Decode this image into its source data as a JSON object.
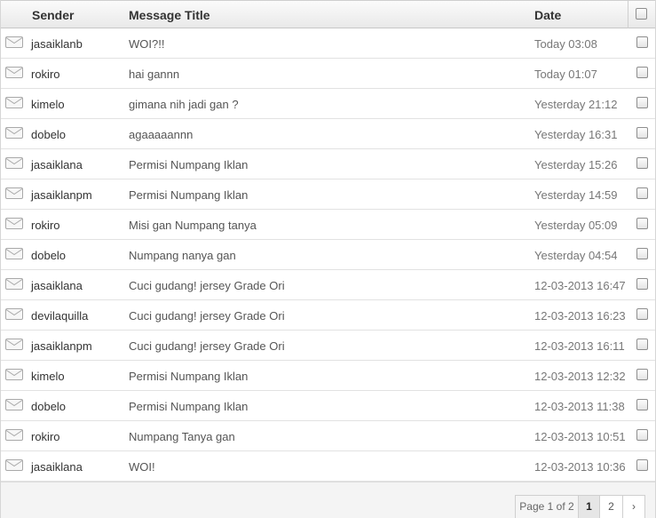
{
  "header": {
    "sender": "Sender",
    "title": "Message Title",
    "date": "Date"
  },
  "icon": "envelope-icon",
  "messages": [
    {
      "sender": "jasaiklanb",
      "title": "WOI?!!",
      "date": "Today 03:08"
    },
    {
      "sender": "rokiro",
      "title": "hai gannn",
      "date": "Today 01:07"
    },
    {
      "sender": "kimelo",
      "title": "gimana nih jadi gan ?",
      "date": "Yesterday 21:12"
    },
    {
      "sender": "dobelo",
      "title": "agaaaaannn",
      "date": "Yesterday 16:31"
    },
    {
      "sender": "jasaiklana",
      "title": "Permisi Numpang Iklan",
      "date": "Yesterday 15:26"
    },
    {
      "sender": "jasaiklanpm",
      "title": "Permisi Numpang Iklan",
      "date": "Yesterday 14:59"
    },
    {
      "sender": "rokiro",
      "title": "Misi gan Numpang tanya",
      "date": "Yesterday 05:09"
    },
    {
      "sender": "dobelo",
      "title": "Numpang nanya gan",
      "date": "Yesterday 04:54"
    },
    {
      "sender": "jasaiklana",
      "title": "Cuci gudang! jersey Grade Ori",
      "date": "12-03-2013 16:47"
    },
    {
      "sender": "devilaquilla",
      "title": "Cuci gudang! jersey Grade Ori",
      "date": "12-03-2013 16:23"
    },
    {
      "sender": "jasaiklanpm",
      "title": "Cuci gudang! jersey Grade Ori",
      "date": "12-03-2013 16:11"
    },
    {
      "sender": "kimelo",
      "title": "Permisi Numpang Iklan",
      "date": "12-03-2013 12:32"
    },
    {
      "sender": "dobelo",
      "title": "Permisi Numpang Iklan",
      "date": "12-03-2013 11:38"
    },
    {
      "sender": "rokiro",
      "title": "Numpang Tanya gan",
      "date": "12-03-2013 10:51"
    },
    {
      "sender": "jasaiklana",
      "title": "WOI!",
      "date": "12-03-2013 10:36"
    }
  ],
  "pagination": {
    "info": "Page 1 of 2",
    "current": "1",
    "next_page": "2",
    "next_arrow": "›"
  }
}
